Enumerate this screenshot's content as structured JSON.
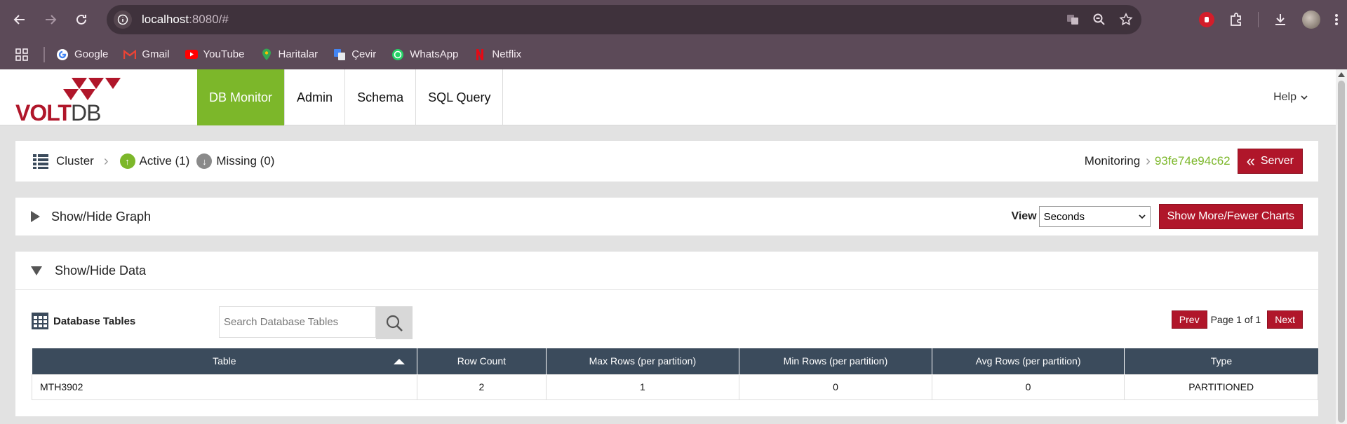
{
  "browser": {
    "url_host": "localhost",
    "url_rest": ":8080/#",
    "bookmarks": [
      {
        "label": "Google",
        "icon": "google-icon"
      },
      {
        "label": "Gmail",
        "icon": "gmail-icon"
      },
      {
        "label": "YouTube",
        "icon": "youtube-icon"
      },
      {
        "label": "Haritalar",
        "icon": "maps-icon"
      },
      {
        "label": "Çevir",
        "icon": "translate-icon"
      },
      {
        "label": "WhatsApp",
        "icon": "whatsapp-icon"
      },
      {
        "label": "Netflix",
        "icon": "netflix-icon"
      }
    ]
  },
  "app": {
    "logo_main": "VOLT",
    "logo_sub": "DB",
    "nav": [
      {
        "label": "DB Monitor",
        "active": true
      },
      {
        "label": "Admin",
        "active": false
      },
      {
        "label": "Schema",
        "active": false
      },
      {
        "label": "SQL Query",
        "active": false
      }
    ],
    "help_label": "Help"
  },
  "cluster": {
    "title": "Cluster",
    "active_label": "Active (1)",
    "missing_label": "Missing (0)",
    "monitoring_label": "Monitoring",
    "server_id": "93fe74e94c62",
    "server_button": "Server"
  },
  "graph": {
    "toggle_label": "Show/Hide Graph",
    "view_label": "View",
    "view_selected": "Seconds",
    "more_button": "Show More/Fewer Charts"
  },
  "data": {
    "toggle_label": "Show/Hide Data",
    "section_title": "Database Tables",
    "search_placeholder": "Search Database Tables",
    "prev_label": "Prev",
    "page_text": "Page 1 of 1",
    "next_label": "Next",
    "columns": [
      "Table",
      "Row Count",
      "Max Rows (per partition)",
      "Min Rows (per partition)",
      "Avg Rows (per partition)",
      "Type"
    ],
    "rows": [
      [
        "MTH3902",
        "2",
        "1",
        "0",
        "0",
        "PARTITIONED"
      ]
    ]
  },
  "colors": {
    "accent_green": "#7cb72a",
    "brand_red": "#b0162a",
    "table_header": "#3b4b5c",
    "chrome_bg": "#5c4a58"
  }
}
